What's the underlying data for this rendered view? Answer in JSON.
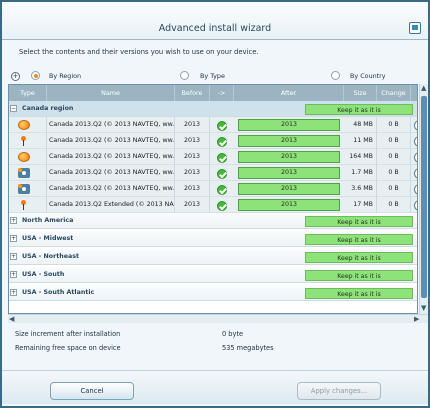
{
  "window": {
    "title": "Advanced install wizard"
  },
  "instruction": "Select the contents and their versions you wish to use on your device.",
  "options": {
    "by_region": "By Region",
    "by_type": "By Type",
    "by_country": "By Country"
  },
  "columns": [
    "Type",
    "Name",
    "Before",
    "->",
    "After",
    "Size",
    "Change"
  ],
  "groups": [
    {
      "name": "Canada region",
      "keep": "Keep it as it is"
    },
    {
      "name": "North America",
      "keep": "Keep it as it is"
    },
    {
      "name": "USA - Midwest",
      "keep": "Keep it as it is"
    },
    {
      "name": "USA - Northeast",
      "keep": "Keep it as it is"
    },
    {
      "name": "USA - South",
      "keep": "Keep it as it is"
    },
    {
      "name": "USA - South Atlantic",
      "keep": "Keep it as it is"
    }
  ],
  "rows": [
    {
      "name": "Canada 2013.Q2 (© 2013 NAVTEQ, ww...",
      "before": "2013",
      "after": "2013",
      "size": "48 MB",
      "change": "0 B",
      "icon": "globe-icon"
    },
    {
      "name": "Canada 2013.Q2 (© 2013 NAVTEQ, ww...",
      "before": "2013",
      "after": "2013",
      "size": "11 MB",
      "change": "0 B",
      "icon": "pin-icon"
    },
    {
      "name": "Canada 2013.Q2 (© 2013 NAVTEQ, ww...",
      "before": "2013",
      "after": "2013",
      "size": "164 MB",
      "change": "0 B",
      "icon": "globe-icon"
    },
    {
      "name": "Canada 2013.Q2 (© 2013 NAVTEQ, ww...",
      "before": "2013",
      "after": "2013",
      "size": "1.7 MB",
      "change": "0 B",
      "icon": "camera-icon"
    },
    {
      "name": "Canada 2013.Q2 (© 2013 NAVTEQ, ww...",
      "before": "2013",
      "after": "2013",
      "size": "3.6 MB",
      "change": "0 B",
      "icon": "camera-icon"
    },
    {
      "name": "Canada 2013.Q2 Extended (© 2013 NA...",
      "before": "2013",
      "after": "2013",
      "size": "17 MB",
      "change": "0 B",
      "icon": "pin-icon"
    }
  ],
  "summary": {
    "size_increment_label": "Size increment after installation",
    "size_increment_value": "0 byte",
    "free_space_label": "Remaining free space on device",
    "free_space_value": "535 megabytes"
  },
  "buttons": {
    "cancel": "Cancel",
    "apply": "Apply changes..."
  }
}
